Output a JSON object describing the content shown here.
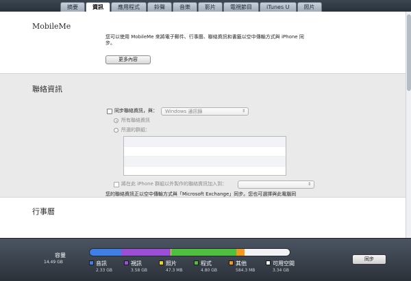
{
  "tabs": [
    "摘要",
    "資訊",
    "應用程式",
    "鈴聲",
    "音樂",
    "影片",
    "電視節目",
    "iTunes U",
    "照片"
  ],
  "mobileme": {
    "title": "MobileMe",
    "description": "您可以使用 MobileMe 來將電子郵件、行事曆、聯絡資訊和書籤以空中傳輸方式與 iPhone 同步。",
    "more_button": "更多內容"
  },
  "contacts": {
    "title": "聯絡資訊",
    "sync_label": "同步聯絡資訊，與：",
    "source_select": "Windows 通訊錄",
    "radio_all": "所有聯絡資訊",
    "radio_selected": "所選的群組：",
    "groups_rows": 4,
    "add_outside_label": "將在此 iPhone 群組以外製作的聯絡資訊加入到：",
    "add_outside_select": "",
    "note": "您的聯絡資訊正以空中傳輸方式與「Microsoft Exchange」同步。您也可選擇與此電腦同步聯絡資訊。"
  },
  "calendar": {
    "title": "行事曆"
  },
  "capacity": {
    "label": "容量",
    "total": "14.49 GB",
    "sync_button": "同步",
    "segments": [
      {
        "name": "音訊",
        "size": "2.33 GB",
        "gb": 2.33,
        "color": "#3f7fe6"
      },
      {
        "name": "視訊",
        "size": "3.58 GB",
        "gb": 3.58,
        "color": "#9b4fd6"
      },
      {
        "name": "照片",
        "size": "47.3 MB",
        "gb": 0.05,
        "color": "#e8d22b"
      },
      {
        "name": "程式",
        "size": "4.80 GB",
        "gb": 4.8,
        "color": "#4fbf3f"
      },
      {
        "name": "其他",
        "size": "584.3 MB",
        "gb": 0.58,
        "color": "#f29a20"
      },
      {
        "name": "可用空間",
        "size": "3.34 GB",
        "gb": 3.34,
        "color": "#f2f2f2"
      }
    ]
  }
}
